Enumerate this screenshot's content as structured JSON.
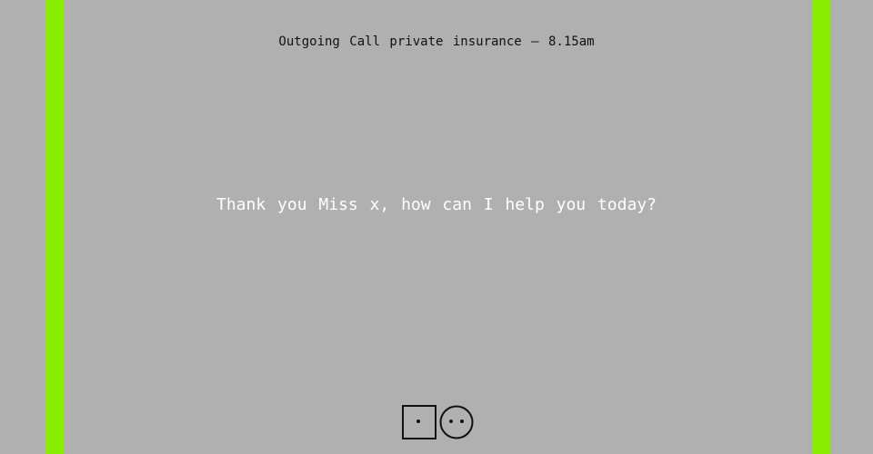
{
  "header": {
    "call_status": "Outgoing Call private insurance – 8.15am"
  },
  "dialogue": {
    "line": "Thank you Miss x, how can I help you today?"
  },
  "controls": {
    "left_icon": "square-dot-icon",
    "right_icon": "smiley-face-icon"
  },
  "colors": {
    "background": "#b0b0b0",
    "accent_bar": "#88ee00",
    "header_text": "#111111",
    "dialogue_text": "#ffffff",
    "icon_stroke": "#111111"
  }
}
